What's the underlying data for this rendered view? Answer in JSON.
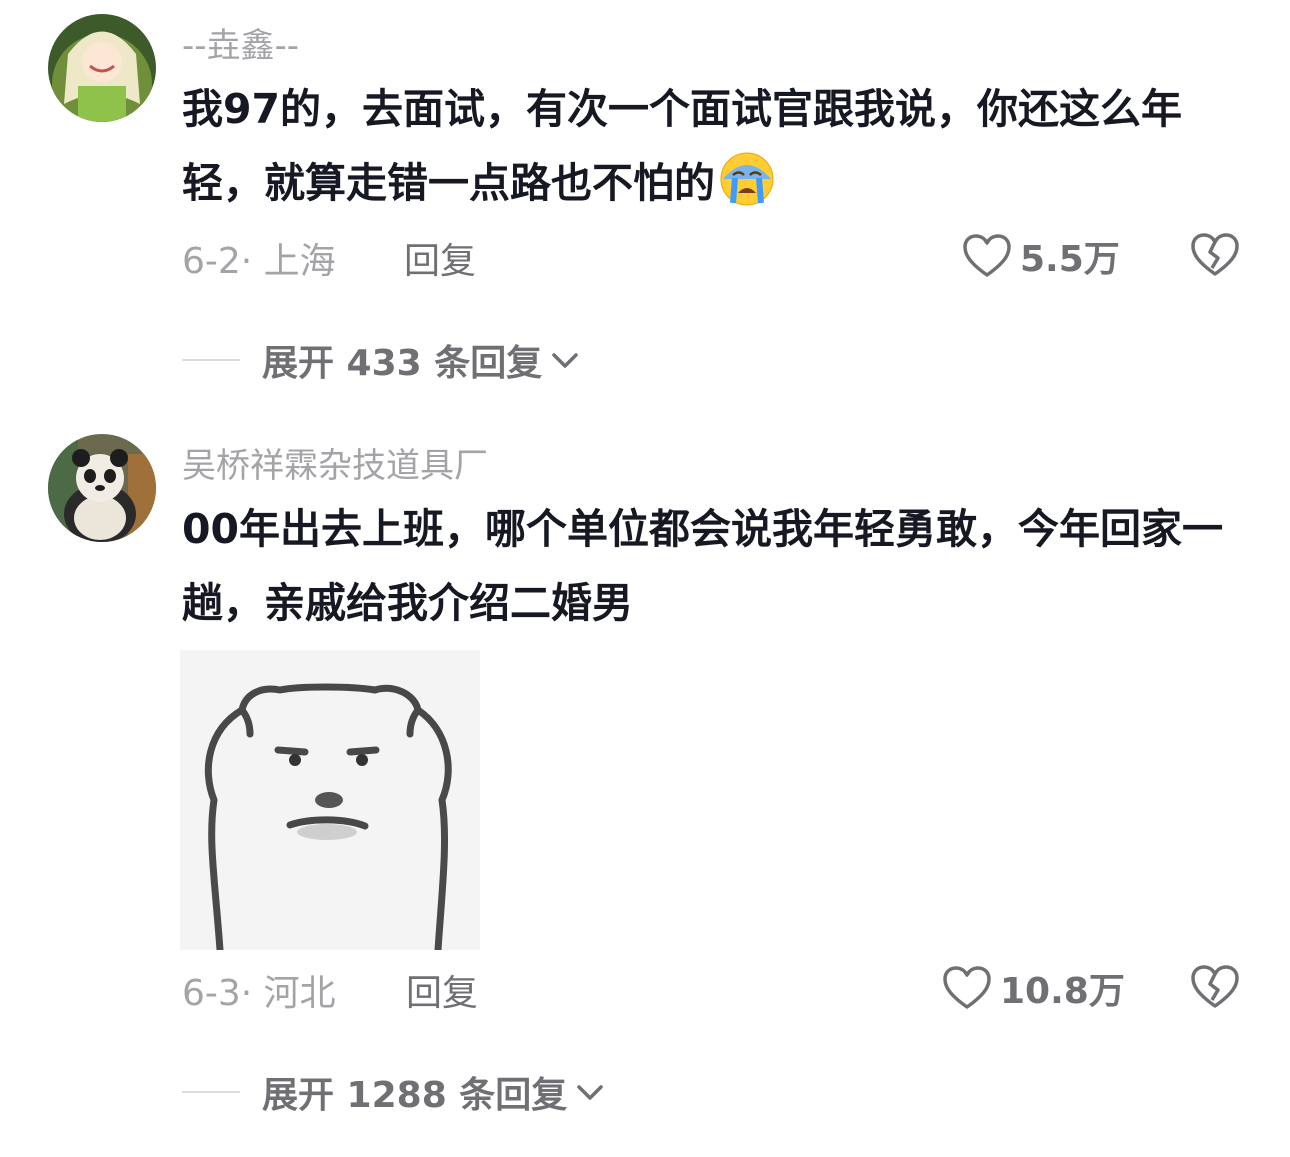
{
  "comments": [
    {
      "username": "--垚鑫--",
      "text": "我97的，去面试，有次一个面试官跟我说，你还这么年轻，就算走错一点路也不怕的",
      "emoji": "crying-face-emoji",
      "date_location": "6-2· 上海",
      "reply_label": "回复",
      "likes": "5.5万",
      "expand_prefix": "展开 ",
      "expand_count": "433",
      "expand_suffix": " 条回复"
    },
    {
      "username": "吴桥祥霖杂技道具厂",
      "text": "00年出去上班，哪个单位都会说我年轻勇敢，今年回家一趟，亲戚给我介绍二婚男",
      "sticker": "bear-face-sticker",
      "date_location": "6-3· 河北",
      "reply_label": "回复",
      "likes": "10.8万",
      "expand_prefix": "展开 ",
      "expand_count": "1288",
      "expand_suffix": " 条回复"
    }
  ],
  "colors": {
    "text": "#161823",
    "muted": "#a4a4a8",
    "secondary": "#6f6f74"
  },
  "icons": [
    "heart-outline-icon",
    "broken-heart-icon",
    "chevron-down-icon"
  ]
}
